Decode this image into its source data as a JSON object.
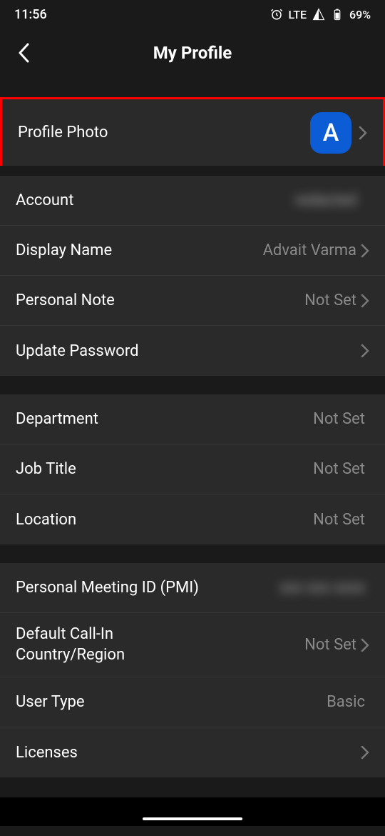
{
  "statusBar": {
    "time": "11:56",
    "network": "LTE",
    "battery": "69%"
  },
  "header": {
    "title": "My Profile"
  },
  "profilePhoto": {
    "label": "Profile Photo",
    "initial": "A"
  },
  "section1": [
    {
      "label": "Account",
      "value": "redacted",
      "blur": true,
      "chevron": false
    },
    {
      "label": "Display Name",
      "value": "Advait Varma",
      "chevron": true
    },
    {
      "label": "Personal Note",
      "value": "Not Set",
      "chevron": true
    },
    {
      "label": "Update Password",
      "value": "",
      "chevron": true
    }
  ],
  "section2": [
    {
      "label": "Department",
      "value": "Not Set",
      "chevron": false
    },
    {
      "label": "Job Title",
      "value": "Not Set",
      "chevron": false
    },
    {
      "label": "Location",
      "value": "Not Set",
      "chevron": false
    }
  ],
  "section3": [
    {
      "label": "Personal Meeting ID (PMI)",
      "value": "redacted",
      "blur": true,
      "chevron": false
    },
    {
      "label": "Default Call-In Country/Region",
      "value": "Not Set",
      "chevron": true,
      "multiline": true
    },
    {
      "label": "User Type",
      "value": "Basic",
      "chevron": false
    },
    {
      "label": "Licenses",
      "value": "",
      "chevron": true
    }
  ]
}
